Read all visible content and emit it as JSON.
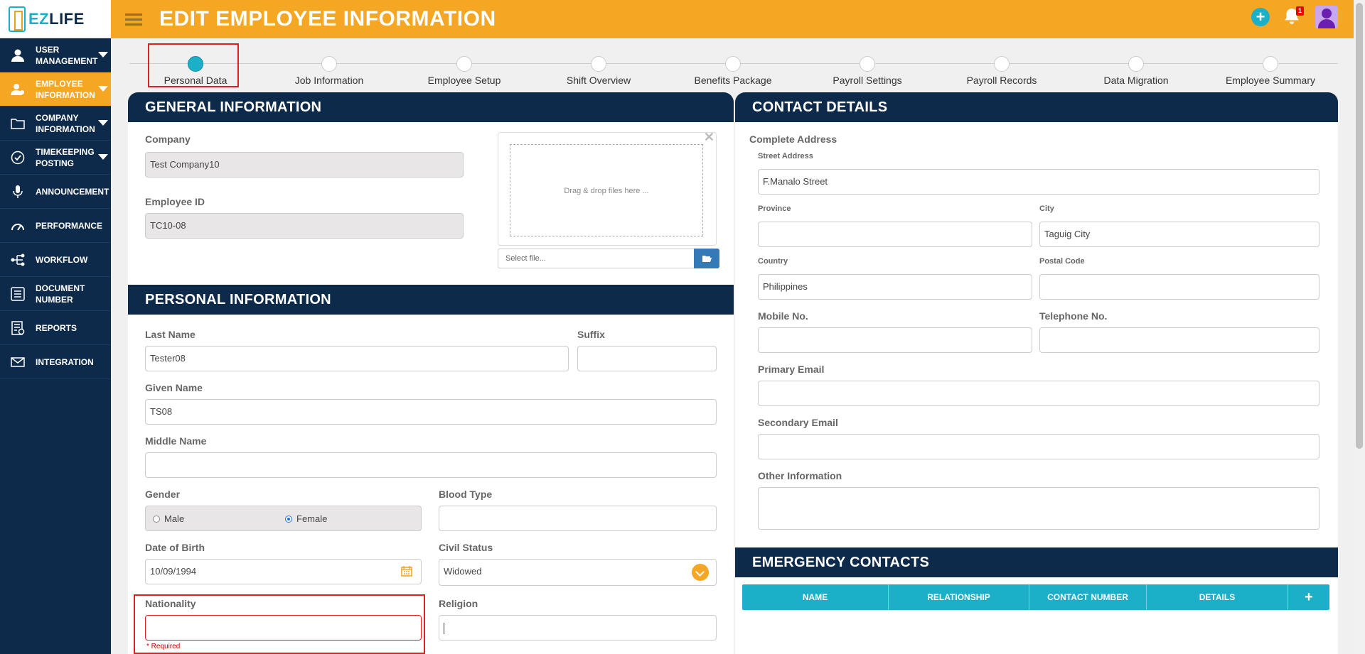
{
  "logo": {
    "ez": "EZ",
    "life": "LIFE"
  },
  "header": {
    "title": "EDIT EMPLOYEE INFORMATION",
    "notification_count": "1"
  },
  "sidebar": {
    "items": [
      {
        "label": "USER MANAGEMENT",
        "icon": "user-icon",
        "active": false,
        "has_caret": true
      },
      {
        "label": "EMPLOYEE INFORMATION",
        "icon": "employee-icon",
        "active": true,
        "has_caret": true
      },
      {
        "label": "COMPANY INFORMATION",
        "icon": "folder-icon",
        "active": false,
        "has_caret": true
      },
      {
        "label": "TIMEKEEPING POSTING",
        "icon": "check-circle-icon",
        "active": false,
        "has_caret": true
      },
      {
        "label": "ANNOUNCEMENT",
        "icon": "microphone-icon",
        "active": false,
        "has_caret": false
      },
      {
        "label": "PERFORMANCE",
        "icon": "gauge-icon",
        "active": false,
        "has_caret": false
      },
      {
        "label": "WORKFLOW",
        "icon": "workflow-icon",
        "active": false,
        "has_caret": false
      },
      {
        "label": "DOCUMENT NUMBER",
        "icon": "list-icon",
        "active": false,
        "has_caret": false
      },
      {
        "label": "REPORTS",
        "icon": "report-icon",
        "active": false,
        "has_caret": false
      },
      {
        "label": "INTEGRATION",
        "icon": "mail-icon",
        "active": false,
        "has_caret": false
      }
    ]
  },
  "steps": [
    "Personal Data",
    "Job Information",
    "Employee Setup",
    "Shift Overview",
    "Benefits Package",
    "Payroll Settings",
    "Payroll Records",
    "Data Migration",
    "Employee Summary"
  ],
  "general": {
    "title": "GENERAL INFORMATION",
    "company_label": "Company",
    "company_value": "Test Company10",
    "employee_id_label": "Employee ID",
    "employee_id_value": "TC10-08",
    "dropzone_text": "Drag & drop files here ...",
    "file_placeholder": "Select file..."
  },
  "personal": {
    "title": "PERSONAL INFORMATION",
    "last_name_label": "Last Name",
    "last_name_value": "Tester08",
    "suffix_label": "Suffix",
    "suffix_value": "",
    "given_name_label": "Given Name",
    "given_name_value": "TS08",
    "middle_name_label": "Middle Name",
    "middle_name_value": "",
    "gender_label": "Gender",
    "gender_male": "Male",
    "gender_female": "Female",
    "gender_selected": "Female",
    "blood_type_label": "Blood Type",
    "blood_type_value": "",
    "dob_label": "Date of Birth",
    "dob_value": "10/09/1994",
    "civil_status_label": "Civil Status",
    "civil_status_value": "Widowed",
    "nationality_label": "Nationality",
    "nationality_value": "",
    "nationality_error": "* Required",
    "religion_label": "Religion",
    "religion_value": ""
  },
  "contact": {
    "title": "CONTACT DETAILS",
    "complete_address_label": "Complete Address",
    "street_label": "Street Address",
    "street_value": "F.Manalo Street",
    "province_label": "Province",
    "province_value": "",
    "city_label": "City",
    "city_value": "Taguig City",
    "country_label": "Country",
    "country_value": "Philippines",
    "postal_label": "Postal Code",
    "postal_value": "",
    "mobile_label": "Mobile No.",
    "mobile_value": "",
    "telephone_label": "Telephone No.",
    "telephone_value": "",
    "primary_email_label": "Primary Email",
    "primary_email_value": "",
    "secondary_email_label": "Secondary Email",
    "secondary_email_value": "",
    "other_info_label": "Other Information",
    "other_info_value": ""
  },
  "emergency": {
    "title": "EMERGENCY CONTACTS",
    "columns": [
      "NAME",
      "RELATIONSHIP",
      "CONTACT NUMBER",
      "DETAILS"
    ],
    "add_symbol": "+"
  },
  "colors": {
    "accent": "#f5a623",
    "navy": "#0e2a4a",
    "teal": "#1bb0c8",
    "error": "#e02020"
  }
}
